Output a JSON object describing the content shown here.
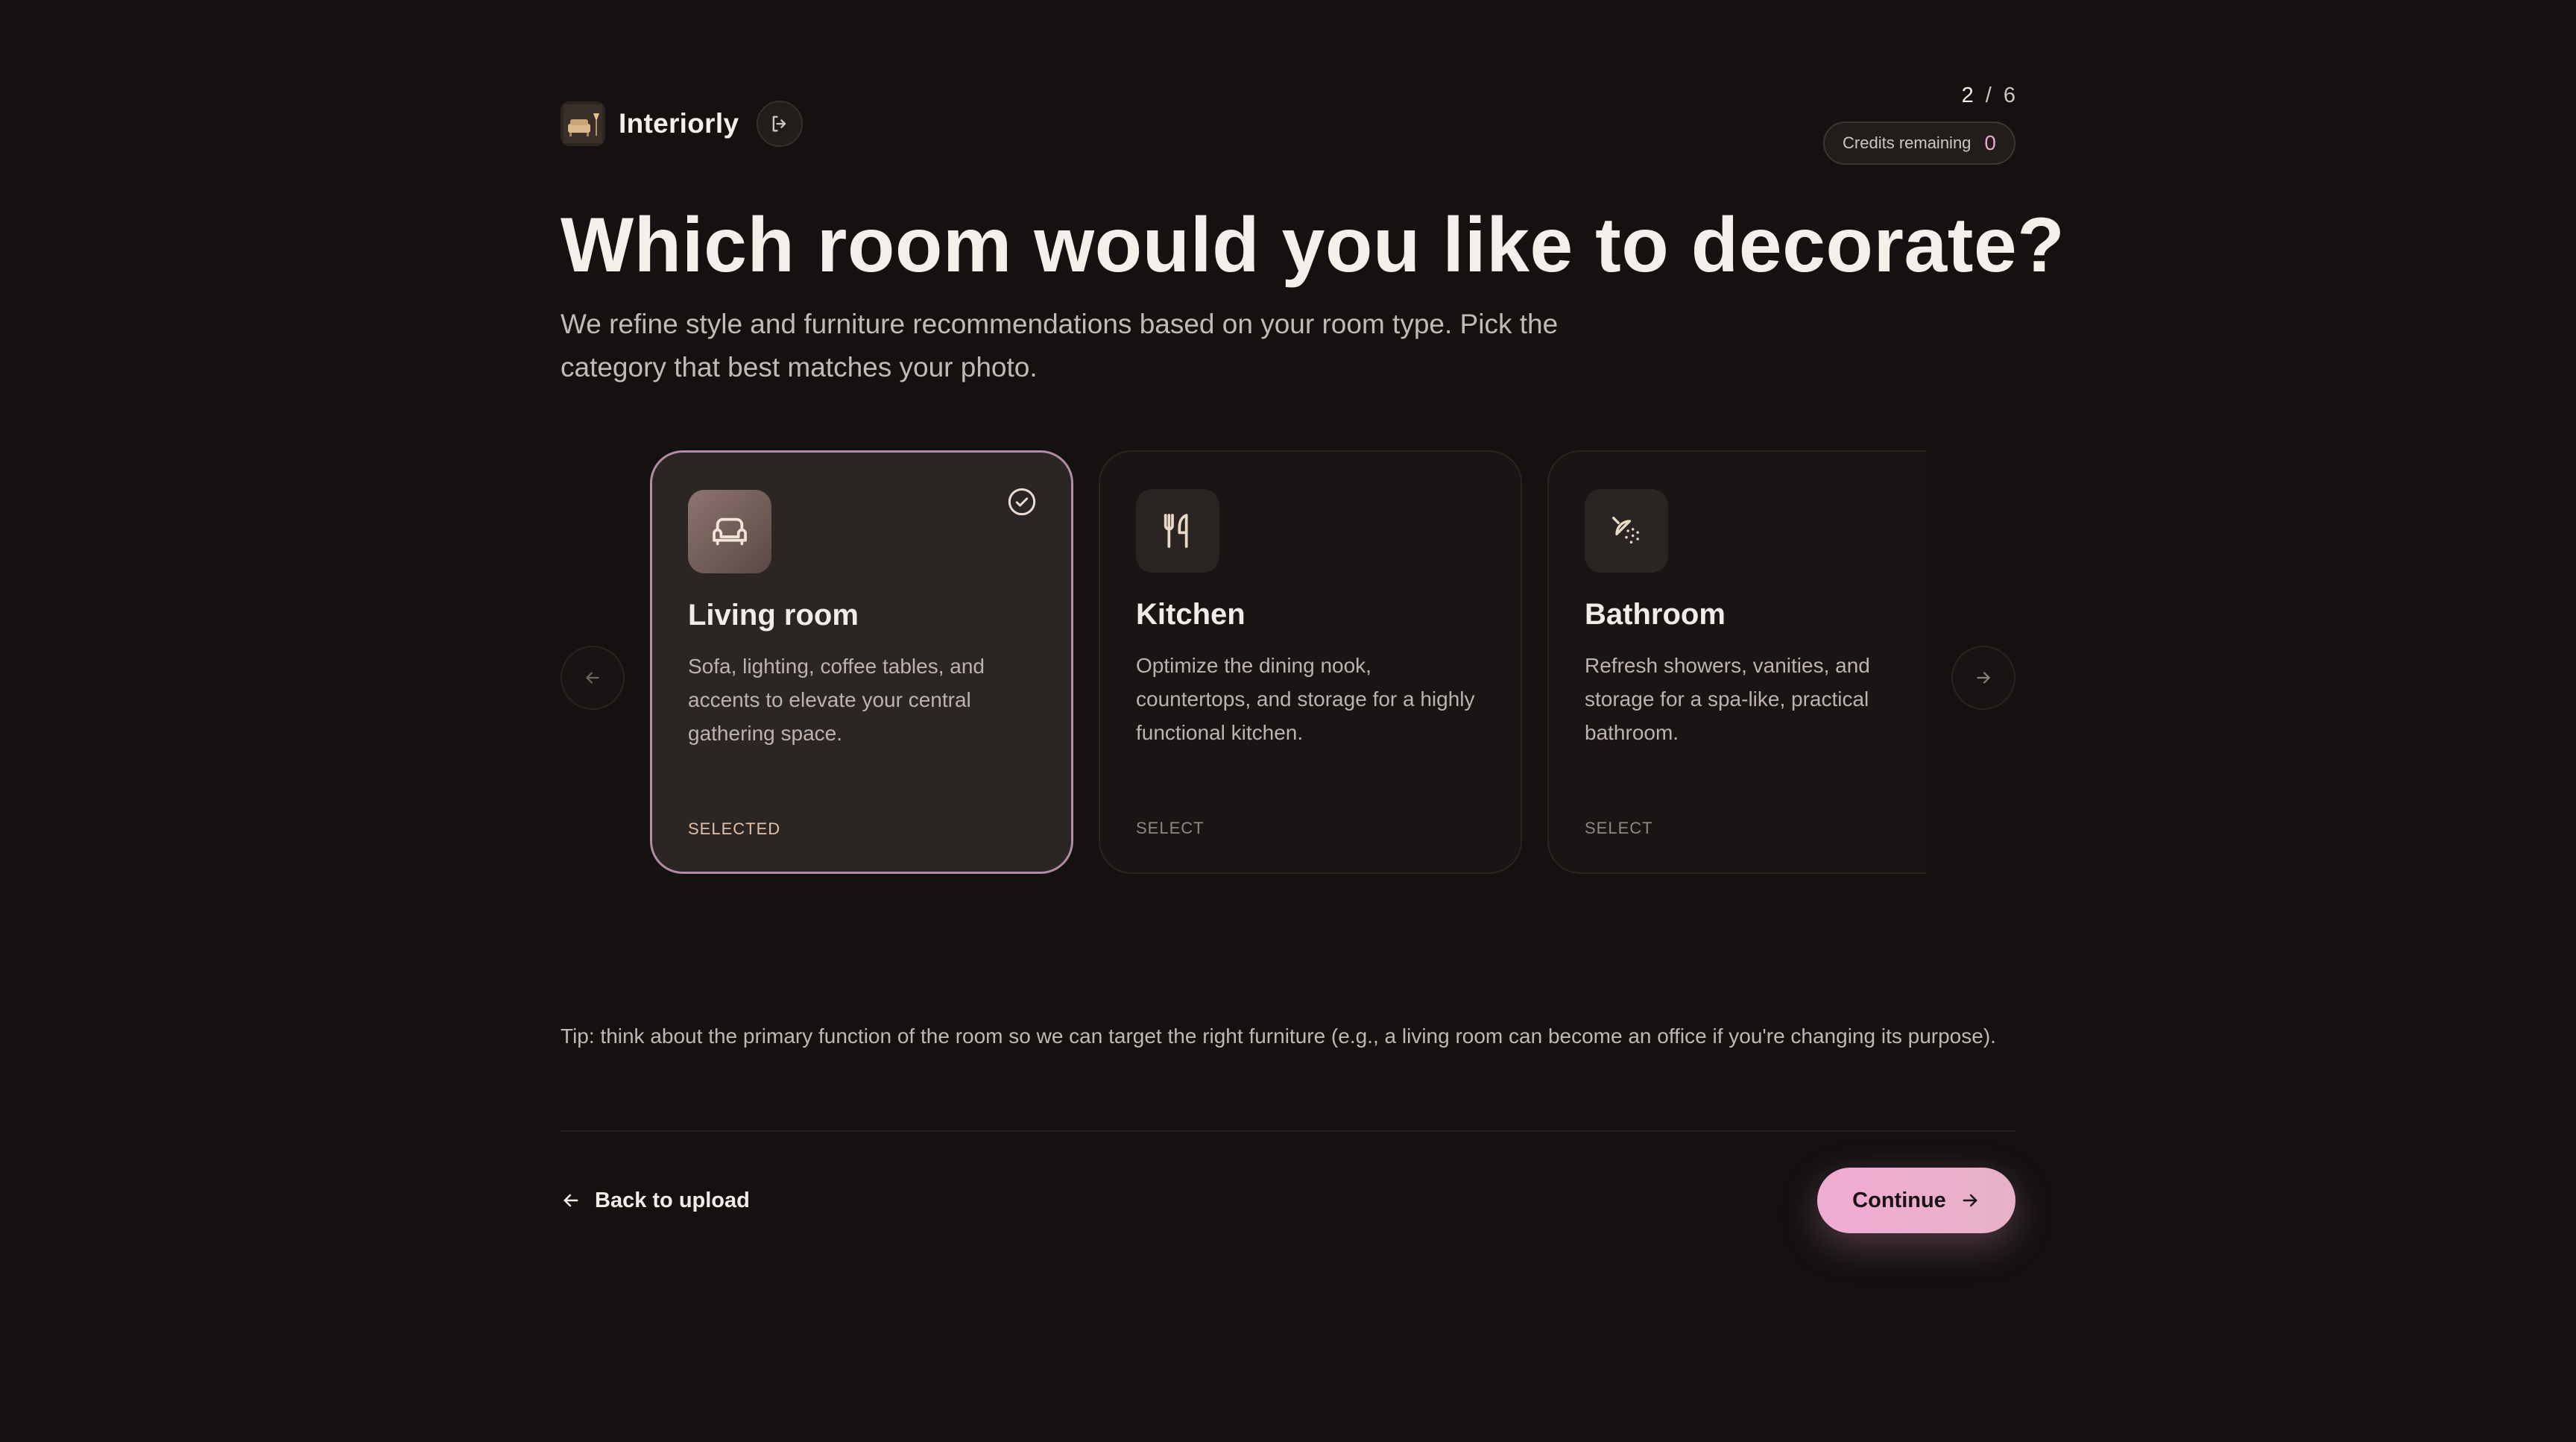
{
  "app": {
    "name": "Interiorly"
  },
  "progress": {
    "current": "2",
    "separator": "/",
    "total": "6"
  },
  "credits": {
    "label": "Credits remaining",
    "value": "0"
  },
  "heading": {
    "title": "Which room would you like to decorate?",
    "subtitle": "We refine style and furniture recommendations based on your room type. Pick the category that best matches your photo."
  },
  "rooms": [
    {
      "name": "Living room",
      "description": "Sofa, lighting, coffee tables, and accents to elevate your central gathering space.",
      "status": "SELECTED",
      "icon": "sofa-icon",
      "selected": true
    },
    {
      "name": "Kitchen",
      "description": "Optimize the dining nook, countertops, and storage for a highly functional kitchen.",
      "status": "SELECT",
      "icon": "utensils-icon",
      "selected": false
    },
    {
      "name": "Bathroom",
      "description": "Refresh showers, vanities, and storage for a spa-like, practical bathroom.",
      "status": "SELECT",
      "icon": "shower-icon",
      "selected": false
    }
  ],
  "tip": "Tip: think about the primary function of the room so we can target the right furniture (e.g., a living room can become an office if you're changing its purpose).",
  "footer": {
    "back_label": "Back to upload",
    "continue_label": "Continue"
  },
  "colors": {
    "background": "#141110",
    "accent": "#f0abd2",
    "selected_border": "#b58aa5",
    "credits_value": "#e8a7d0"
  }
}
